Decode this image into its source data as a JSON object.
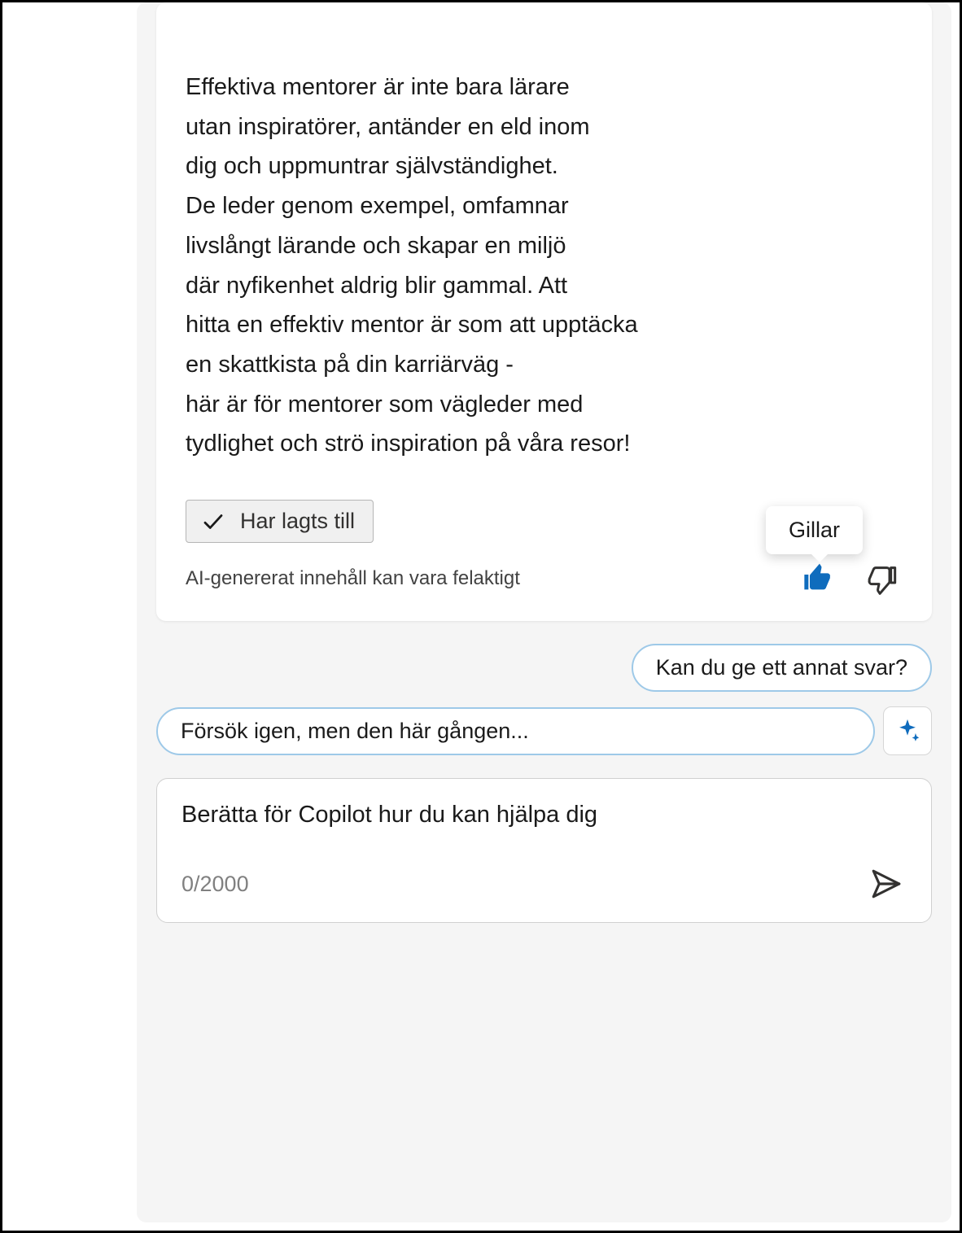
{
  "message": {
    "body": "Effektiva mentorer är inte bara lärare\nutan inspiratörer, antänder en eld inom\ndig och uppmuntrar självständighet.\nDe leder genom exempel, omfamnar\nlivslångt lärande och skapar en miljö\ndär nyfikenhet aldrig blir gammal. Att\nhitta en effektiv mentor är som att upptäcka\nen skattkista på din karriärväg -\nhär är för mentorer som vägleder med\ntydlighet och strö inspiration på våra resor!",
    "added_label": "Har lagts till",
    "disclaimer": "AI-genererat innehåll kan vara felaktigt",
    "tooltip_like": "Gillar"
  },
  "suggestions": {
    "item1": "Kan du ge ett annat svar?",
    "item2": "Försök igen, men den här gången..."
  },
  "input": {
    "placeholder": "Berätta för Copilot hur du kan hjälpa dig",
    "char_count": "0/2000"
  },
  "colors": {
    "accent": "#0f6cbd",
    "pill_border": "#9ec9e8"
  }
}
